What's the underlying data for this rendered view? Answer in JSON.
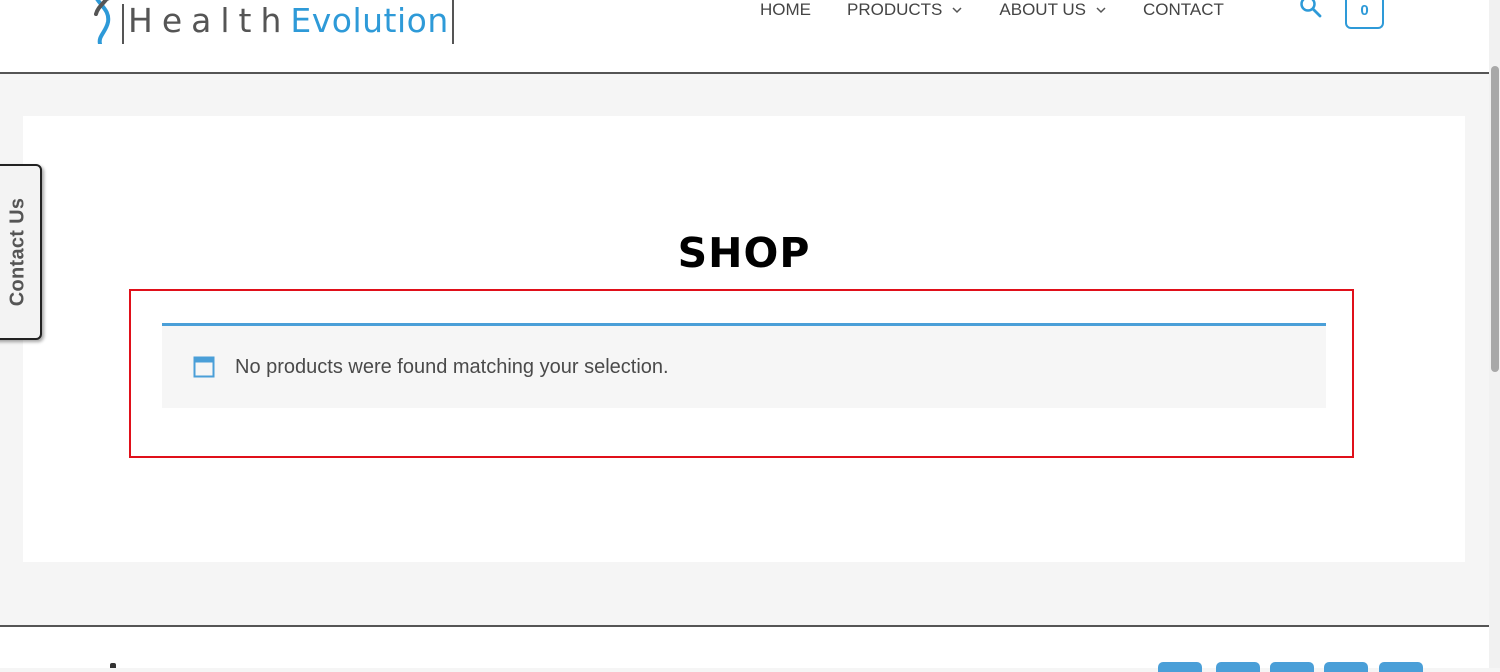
{
  "brand": {
    "name_part1": "Health",
    "name_part2": "Evolution",
    "color_primary": "#2e9ad8",
    "color_text": "#555555"
  },
  "nav": {
    "items": [
      {
        "label": "HOME",
        "has_dropdown": false
      },
      {
        "label": "PRODUCTS",
        "has_dropdown": true
      },
      {
        "label": "ABOUT US",
        "has_dropdown": true
      },
      {
        "label": "CONTACT",
        "has_dropdown": false
      }
    ],
    "search_icon": "search-icon",
    "cart_count": "0"
  },
  "page": {
    "title": "SHOP",
    "notice": {
      "icon": "window-icon",
      "message": "No products were found matching your selection.",
      "accent": "#4a9fd8"
    },
    "highlight_color": "#e0101a"
  },
  "contact_tab": {
    "label": "Contact Us"
  },
  "footer": {
    "social_button_count": 5,
    "social_color": "#4a9fd8"
  }
}
